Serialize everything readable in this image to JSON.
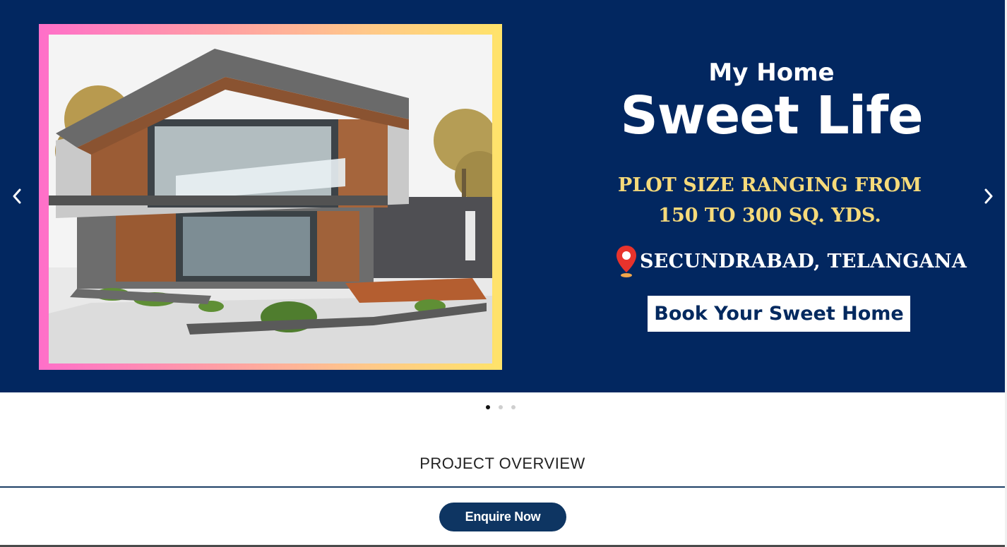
{
  "hero": {
    "title_small": "My Home",
    "title_big": "Sweet Life",
    "plot_line1": "PLOT SIZE RANGING FROM",
    "plot_line2": "150 TO 300 SQ. YDS.",
    "location": "SECUNDRABAD, TELANGANA",
    "book_button": "Book Your Sweet Home",
    "prev_icon": "chevron-left-icon",
    "next_icon": "chevron-right-icon",
    "location_icon": "map-pin-icon"
  },
  "carousel": {
    "slide_count": 3,
    "active_index": 0
  },
  "section": {
    "title": "PROJECT OVERVIEW"
  },
  "cta": {
    "enquire_label": "Enquire Now"
  },
  "colors": {
    "hero_bg": "#022760",
    "accent_gold": "#f6da7a",
    "button_navy": "#0e3562"
  }
}
